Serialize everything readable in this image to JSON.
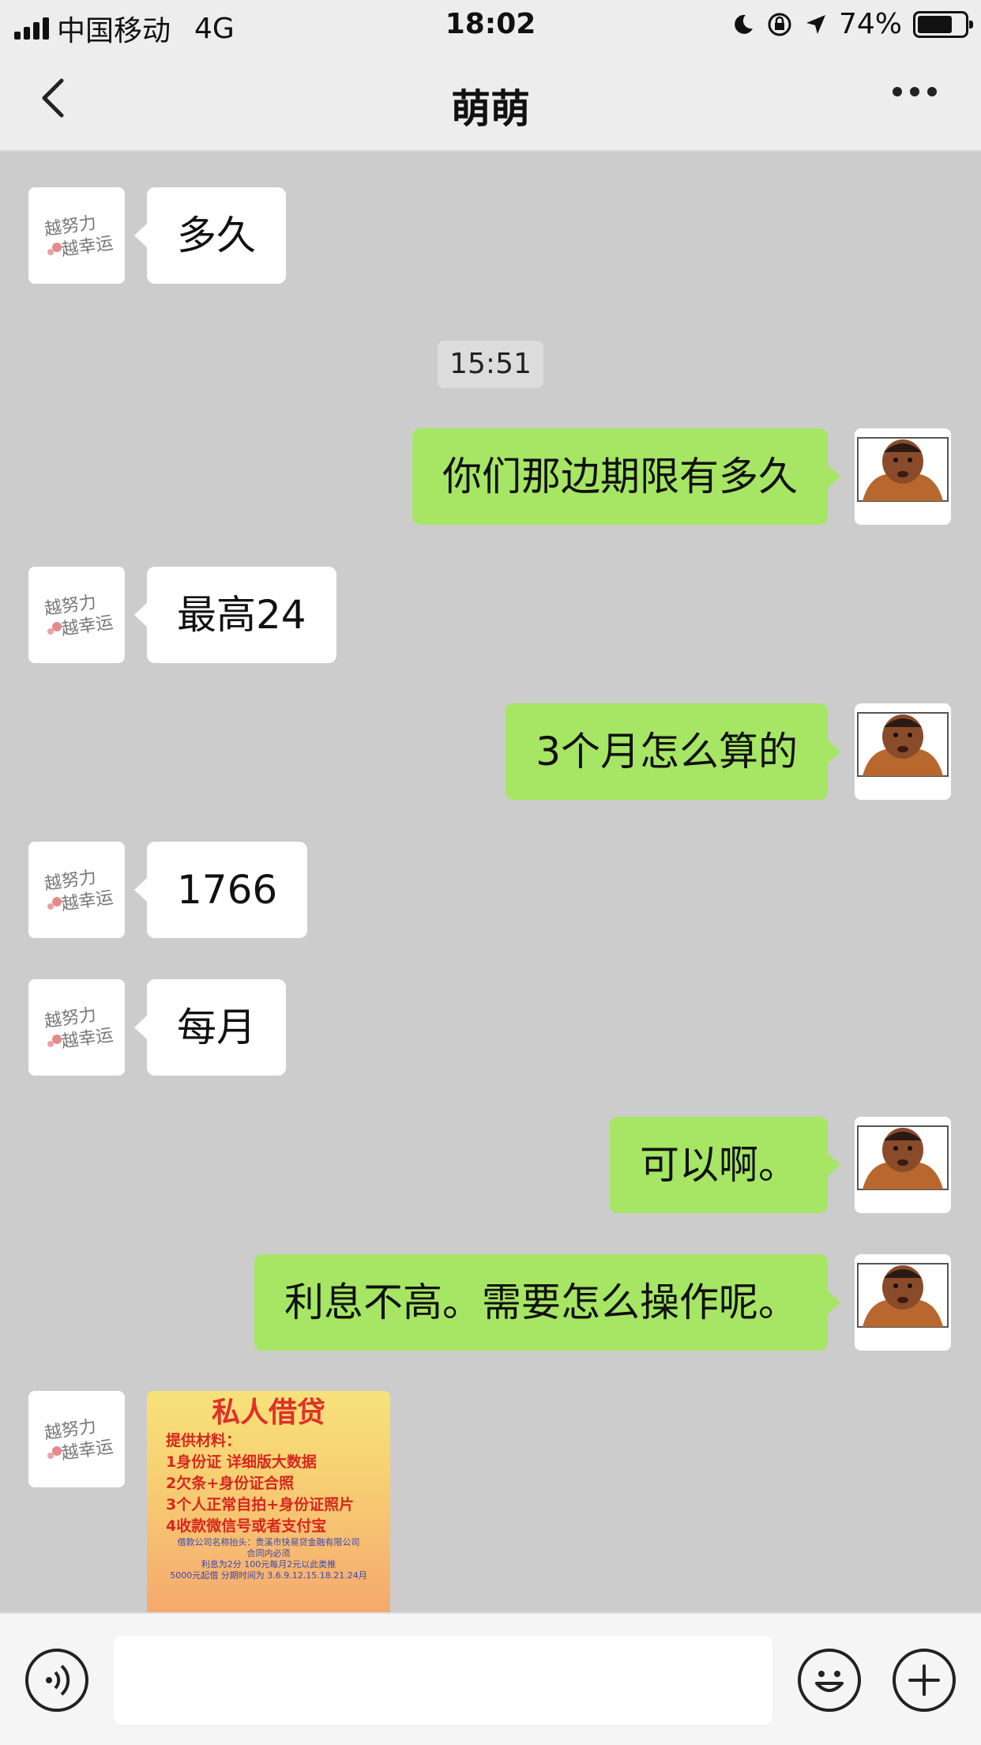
{
  "status_bar": {
    "carrier": "中国移动",
    "network": "4G",
    "time": "18:02",
    "battery": "74%",
    "battery_level": 0.74
  },
  "header": {
    "title": "萌萌"
  },
  "messages": [
    {
      "side": "in",
      "text": "多久"
    },
    {
      "side": "time",
      "text": "15:51"
    },
    {
      "side": "out",
      "text": "你们那边期限有多久"
    },
    {
      "side": "in",
      "text": "最高24"
    },
    {
      "side": "out",
      "text": "3个月怎么算的"
    },
    {
      "side": "in",
      "text": "1766"
    },
    {
      "side": "in",
      "text": "每月"
    },
    {
      "side": "out",
      "text": "可以啊。"
    },
    {
      "side": "out",
      "text": "利息不高。需要怎么操作呢。"
    }
  ],
  "loan_image": {
    "title": "私人借贷",
    "lines": [
      "提供材料：",
      "1身份证  详细版大数据",
      "2欠条+身份证合照",
      "3个人正常自拍+身份证照片",
      "4收款微信号或者支付宝"
    ],
    "small_lines": [
      "借款公司名称抬头：贵溪市快易贷金融有限公司",
      "合同内必须",
      "利息为2分  100元每月2元以此类推",
      "5000元起借 分期时间为 3.6.9.12.15.18.21.24月"
    ]
  },
  "input_bar": {
    "placeholder": ""
  },
  "colors": {
    "outgoing_bubble": "#a6e664",
    "incoming_bubble": "#ffffff",
    "chat_background": "#cccccc"
  }
}
